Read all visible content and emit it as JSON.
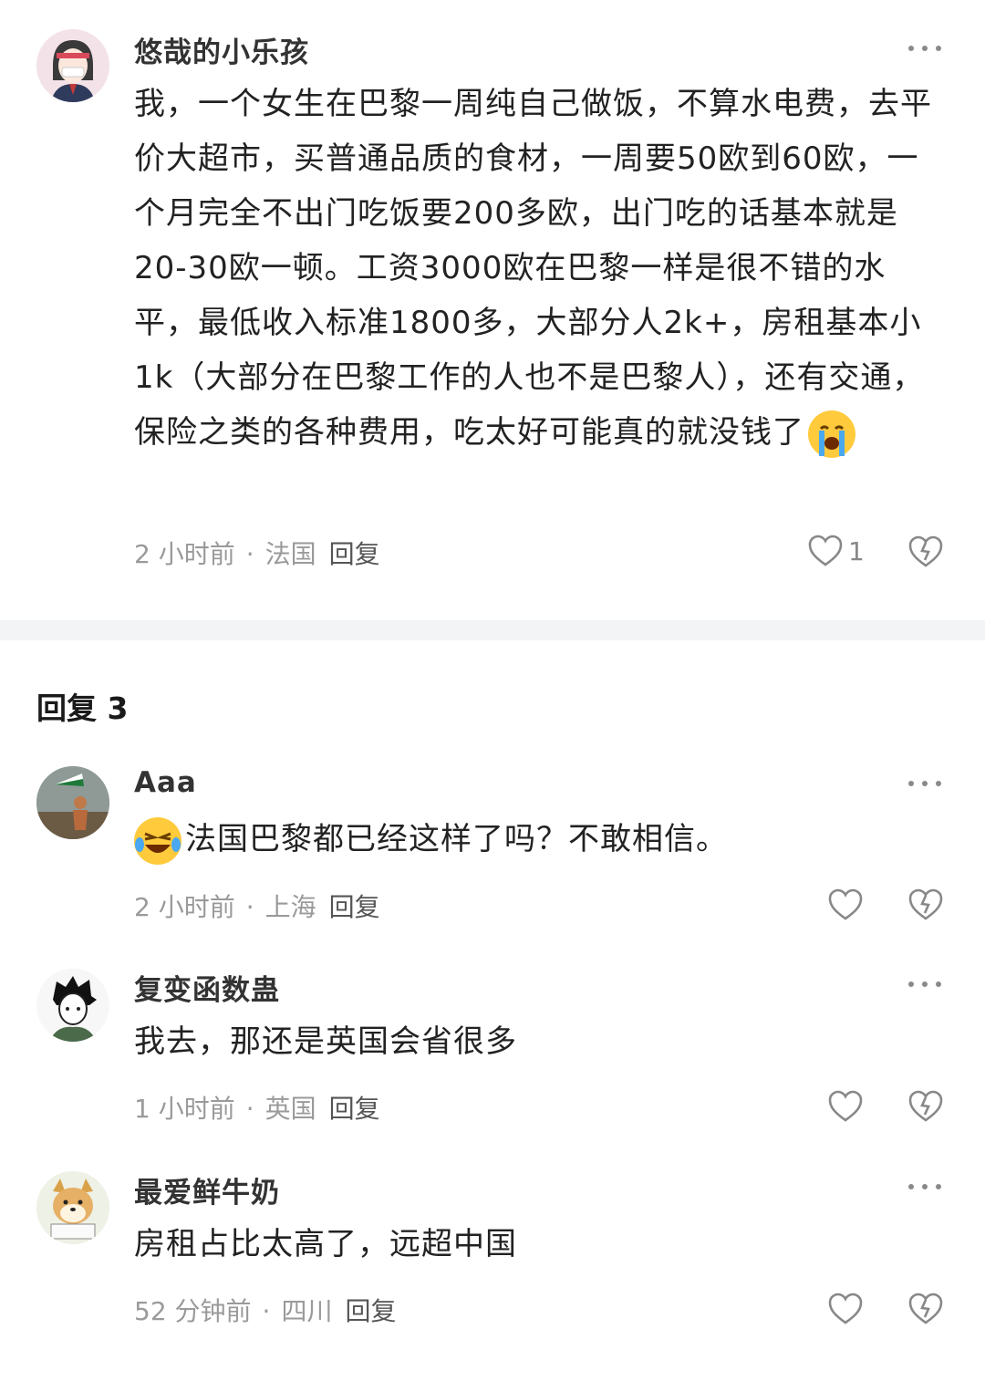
{
  "main_comment": {
    "username": "悠哉的小乐孩",
    "text": "我，一个女生在巴黎一周纯自己做饭，不算水电费，去平价大超市，买普通品质的食材，一周要50欧到60欧，一个月完全不出门吃饭要200多欧，出门吃的话基本就是20-30欧一顿。工资3000欧在巴黎一样是很不错的水平，最低收入标准1800多，大部分人2k+，房租基本小1k（大部分在巴黎工作的人也不是巴黎人），还有交通，保险之类的各种费用，吃太好可能真的就没钱了",
    "emoji": "crying-face-emoji",
    "time": "2 小时前",
    "location": "法国",
    "reply_label": "回复",
    "like_count": "1"
  },
  "replies_header": "回复 3",
  "replies": [
    {
      "username": "Aaa",
      "emoji": "laughing-tears-emoji",
      "text": "法国巴黎都已经这样了吗？不敢相信。",
      "time": "2 小时前",
      "location": "上海",
      "reply_label": "回复"
    },
    {
      "username": "复变函数蛊",
      "text": "我去，那还是英国会省很多",
      "time": "1 小时前",
      "location": "英国",
      "reply_label": "回复"
    },
    {
      "username": "最爱鲜牛奶",
      "text": "房租占比太高了，远超中国",
      "time": "52 分钟前",
      "location": "四川",
      "reply_label": "回复"
    }
  ],
  "meta_separator": "·",
  "icons": [
    "more-icon",
    "heart-icon",
    "dislike-icon"
  ]
}
